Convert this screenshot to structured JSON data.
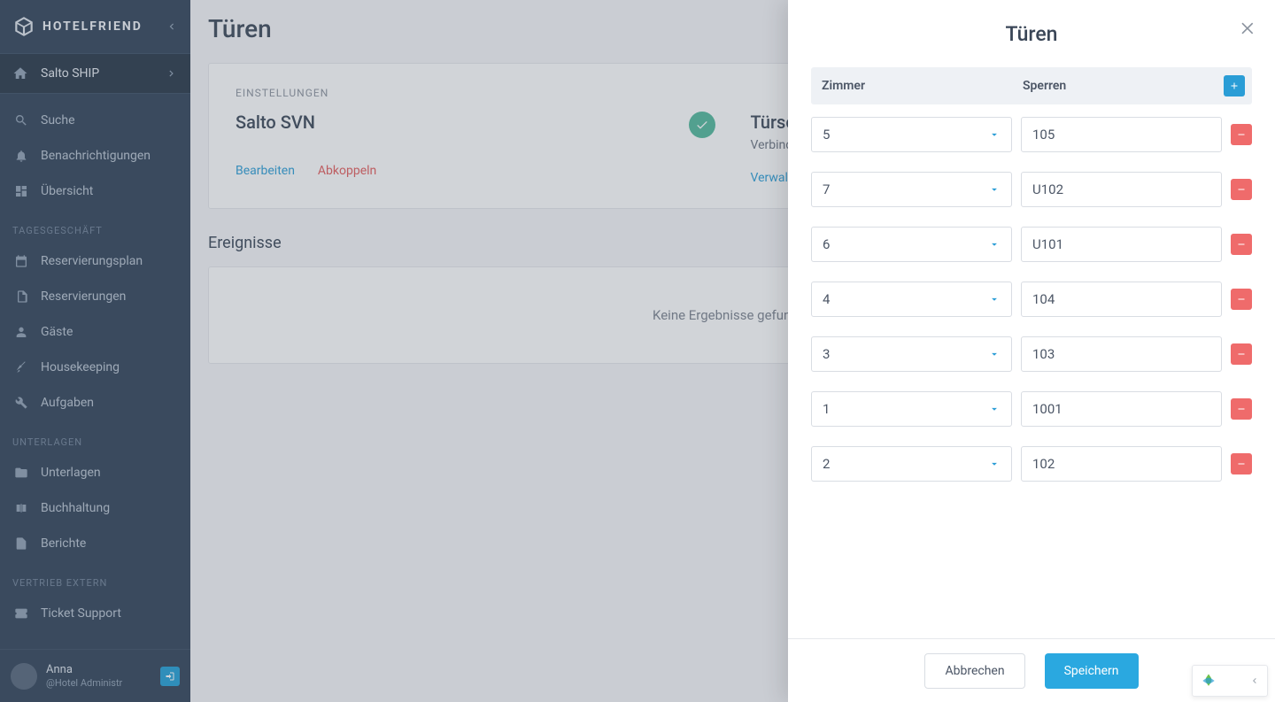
{
  "brand": "HOTELFRIEND",
  "active_module": "Salto SHIP",
  "sidebar": {
    "items_top": [
      {
        "label": "Suche",
        "icon": "search"
      },
      {
        "label": "Benachrichtigungen",
        "icon": "bell"
      },
      {
        "label": "Übersicht",
        "icon": "dashboard"
      }
    ],
    "section1_label": "TAGESGESCHÄFT",
    "items1": [
      {
        "label": "Reservierungsplan",
        "icon": "calendar"
      },
      {
        "label": "Reservierungen",
        "icon": "clipboard"
      },
      {
        "label": "Gäste",
        "icon": "person"
      },
      {
        "label": "Housekeeping",
        "icon": "broom"
      },
      {
        "label": "Aufgaben",
        "icon": "wrench"
      }
    ],
    "section2_label": "UNTERLAGEN",
    "items2": [
      {
        "label": "Unterlagen",
        "icon": "folder"
      },
      {
        "label": "Buchhaltung",
        "icon": "book"
      },
      {
        "label": "Berichte",
        "icon": "report"
      }
    ],
    "section3_label": "VERTRIEB EXTERN",
    "items3": [
      {
        "label": "Ticket Support",
        "icon": "ticket"
      }
    ]
  },
  "user": {
    "name": "Anna",
    "role": "@Hotel Administr"
  },
  "page": {
    "title": "Türen",
    "settings_eyebrow": "EINSTELLUNGEN",
    "salto_title": "Salto SVN",
    "salto_edit": "Bearbeiten",
    "salto_disconnect": "Abkoppeln",
    "connect_title": "Türschlösser verbinden",
    "connect_sub": "Verbinde Zimmer mit Türschloss in Sa",
    "connect_manage": "Verwalten",
    "events_heading": "Ereignisse",
    "events_empty": "Keine Ergebnisse gefunden"
  },
  "modal": {
    "title": "Türen",
    "th_rooms": "Zimmer",
    "th_locks": "Sperren",
    "rows": [
      {
        "room": "5",
        "lock": "105"
      },
      {
        "room": "7",
        "lock": "U102"
      },
      {
        "room": "6",
        "lock": "U101"
      },
      {
        "room": "4",
        "lock": "104"
      },
      {
        "room": "3",
        "lock": "103"
      },
      {
        "room": "1",
        "lock": "1001"
      },
      {
        "room": "2",
        "lock": "102"
      }
    ],
    "cancel": "Abbrechen",
    "save": "Speichern"
  }
}
